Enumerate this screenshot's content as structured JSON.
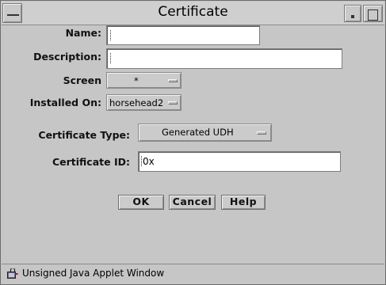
{
  "window": {
    "title": "Certificate",
    "status_text": "Unsigned Java Applet Window"
  },
  "form": {
    "name_label": "Name:",
    "name_value": "",
    "description_label": "Description:",
    "description_value": "",
    "screen_label": "Screen",
    "screen_value": "*",
    "installed_on_label": "Installed On:",
    "installed_on_value": "horsehead2",
    "certificate_type_label": "Certificate Type:",
    "certificate_type_value": "Generated UDH",
    "certificate_id_label": "Certificate ID:",
    "certificate_id_value": "0x"
  },
  "buttons": {
    "ok": "OK",
    "cancel": "Cancel",
    "help": "Help"
  },
  "icons": {
    "window_menu": "window-menu-icon",
    "minimize": "minimize-icon",
    "maximize": "maximize-icon",
    "applet_lock": "unsigned-applet-icon"
  }
}
